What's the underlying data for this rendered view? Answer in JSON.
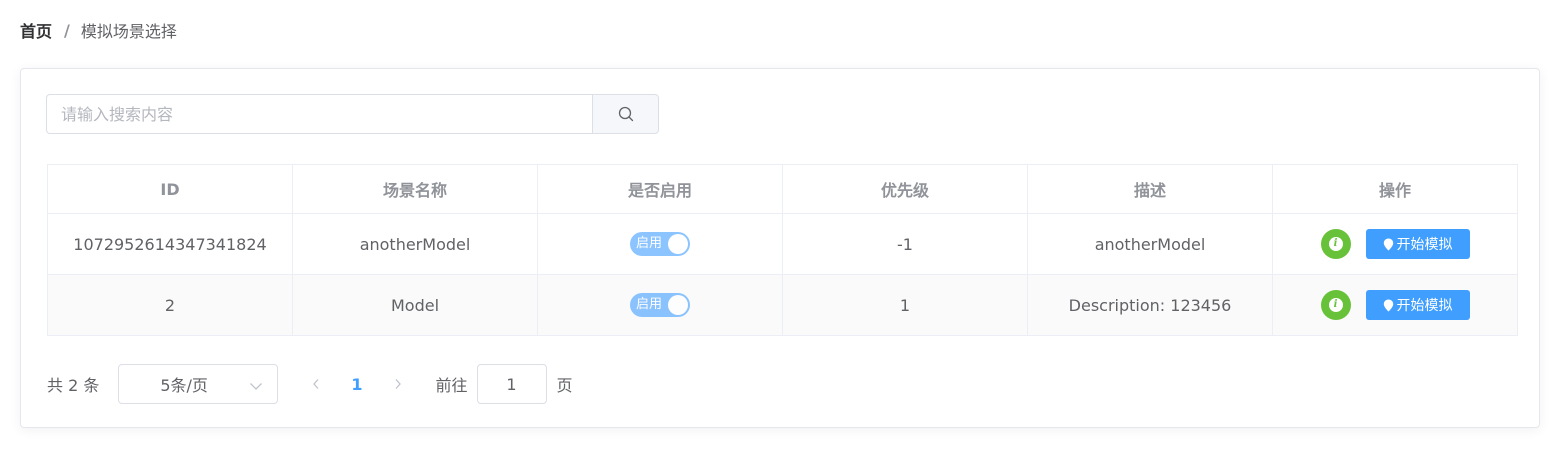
{
  "breadcrumb": {
    "home": "首页",
    "separator": "/",
    "current": "模拟场景选择"
  },
  "search": {
    "placeholder": "请输入搜索内容",
    "value": "",
    "icon": "search-icon"
  },
  "table": {
    "columns": [
      "ID",
      "场景名称",
      "是否启用",
      "优先级",
      "描述",
      "操作"
    ],
    "rows": [
      {
        "id": "1072952614347341824",
        "name": "anotherModel",
        "enabled": true,
        "enabled_label": "启用",
        "priority": "-1",
        "description": "anotherModel",
        "info_icon": "info-icon",
        "action_label": "开始模拟"
      },
      {
        "id": "2",
        "name": "Model",
        "enabled": true,
        "enabled_label": "启用",
        "priority": "1",
        "description": "Description: 123456",
        "info_icon": "info-icon",
        "action_label": "开始模拟"
      }
    ]
  },
  "pagination": {
    "total_text": "共 2 条",
    "page_size": "5条/页",
    "current_page": "1",
    "goto_label": "前往",
    "goto_value": "1",
    "page_suffix": "页"
  },
  "colors": {
    "primary": "#409eff",
    "success": "#67c23a",
    "border": "#ebeef5",
    "text": "#606266",
    "header_text": "#909399"
  }
}
